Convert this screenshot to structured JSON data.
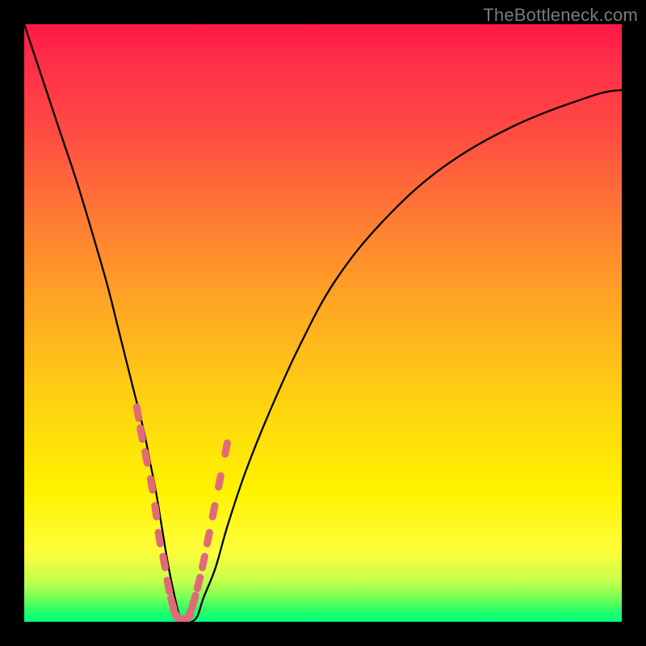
{
  "watermark": "TheBottleneck.com",
  "chart_data": {
    "type": "line",
    "title": "",
    "xlabel": "",
    "ylabel": "",
    "xlim": [
      0,
      100
    ],
    "ylim": [
      0,
      100
    ],
    "series": [
      {
        "name": "bottleneck-curve",
        "x": [
          0,
          3,
          6,
          9,
          12,
          14,
          16,
          18,
          20,
          21,
          22,
          23,
          24,
          25,
          26,
          27,
          28,
          29,
          30,
          32,
          34,
          37,
          41,
          46,
          52,
          60,
          70,
          82,
          95,
          100
        ],
        "y": [
          100,
          91,
          82,
          73,
          63,
          56,
          48,
          40,
          32,
          27,
          22,
          16,
          10,
          5,
          1,
          0,
          0,
          1,
          4,
          9,
          16,
          25,
          35,
          46,
          57,
          67,
          76,
          83,
          88,
          89
        ]
      }
    ],
    "markers": {
      "name": "hotspot-dots",
      "color": "#e06b77",
      "x": [
        19.0,
        19.6,
        20.4,
        21.3,
        22.0,
        22.6,
        23.4,
        24.1,
        24.8,
        25.5,
        26.3,
        27.0,
        27.7,
        28.4,
        29.2,
        30.0,
        30.8,
        31.7,
        32.7,
        33.8
      ],
      "y": [
        35.0,
        31.5,
        27.5,
        23.0,
        18.5,
        14.0,
        10.0,
        6.0,
        3.0,
        1.0,
        0.5,
        0.5,
        1.5,
        3.5,
        6.5,
        10.0,
        14.0,
        18.5,
        23.5,
        29.0
      ]
    },
    "background_gradient": {
      "orientation": "vertical",
      "stops": [
        {
          "pos": 0,
          "color": "#ff1846"
        },
        {
          "pos": 32,
          "color": "#ff7a35"
        },
        {
          "pos": 62,
          "color": "#ffcf12"
        },
        {
          "pos": 88,
          "color": "#fffd3a"
        },
        {
          "pos": 100,
          "color": "#00ff7b"
        }
      ]
    }
  }
}
